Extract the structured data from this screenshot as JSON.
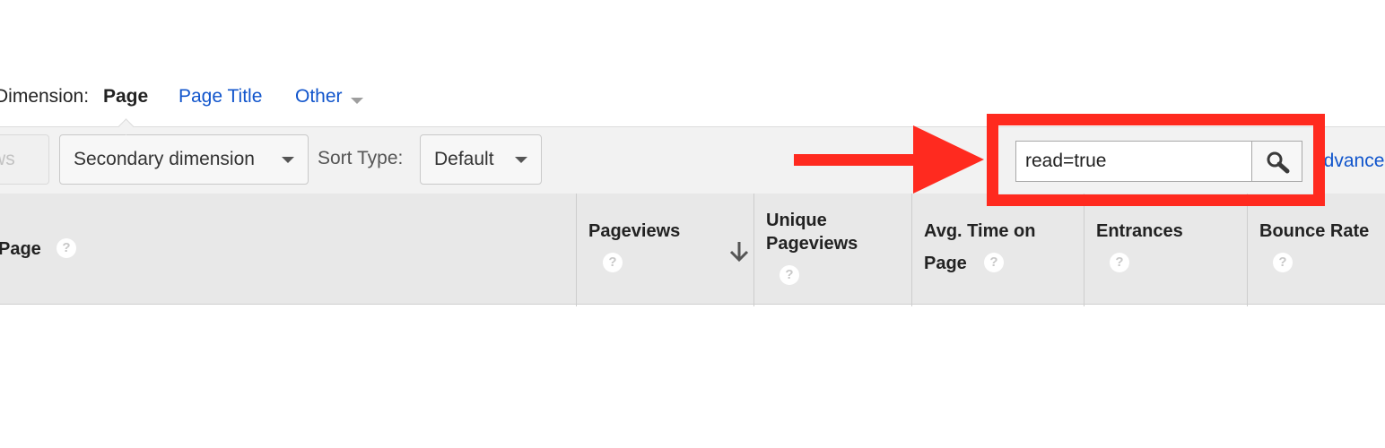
{
  "dimension_bar": {
    "label": "Dimension:",
    "active": "Page",
    "options": [
      "Page Title",
      "Other"
    ]
  },
  "toolbar": {
    "rows_button_label": "Show rows",
    "secondary_dimension_label": "Secondary dimension",
    "sort_type_label": "Sort Type:",
    "sort_type_value": "Default",
    "search_value": "read=true",
    "advanced_link": "advanced"
  },
  "table": {
    "columns": [
      {
        "line1": "Page",
        "line2": ""
      },
      {
        "line1": "Pageviews",
        "line2": ""
      },
      {
        "line1": "Unique",
        "line2": "Pageviews"
      },
      {
        "line1": "Avg. Time on",
        "line2": "Page"
      },
      {
        "line1": "Entrances",
        "line2": ""
      },
      {
        "line1": "Bounce Rate",
        "line2": ""
      }
    ],
    "help_glyph": "?"
  },
  "icons": {
    "search": "magnifier-icon",
    "sort": "arrow-down-icon",
    "annotation": "red-arrow-icon"
  },
  "colors": {
    "link": "#1155cc",
    "annotation": "#ff2a1f",
    "toolbar_bg": "#f2f2f2",
    "header_bg": "#e8e8e8"
  }
}
